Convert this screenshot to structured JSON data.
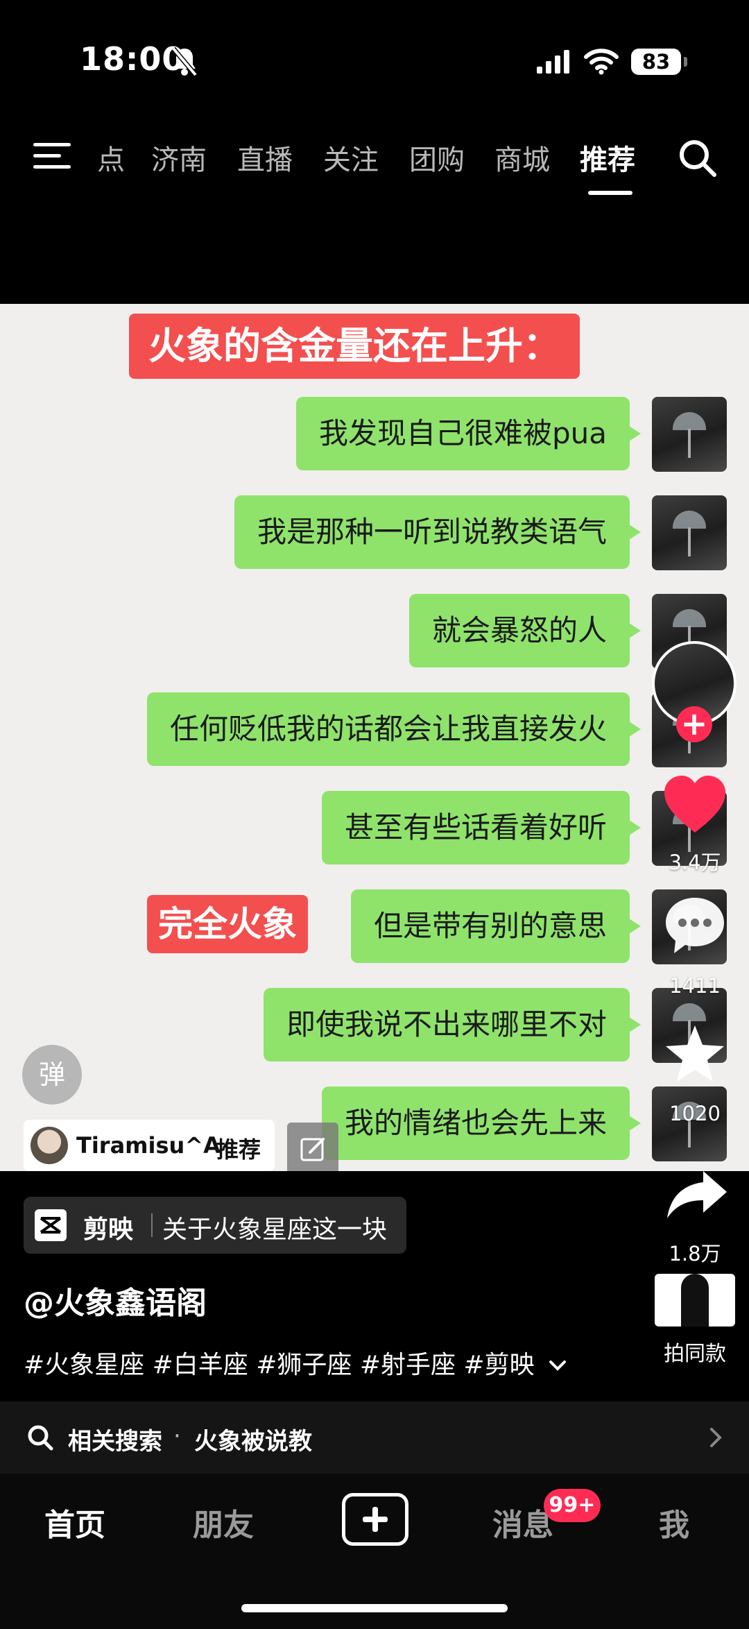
{
  "status_bar": {
    "time": "18:00",
    "battery": "83"
  },
  "top_tabs": [
    "点",
    "济南",
    "直播",
    "关注",
    "团购",
    "商城",
    "推荐"
  ],
  "video": {
    "title": "火象的含金量还在上升：",
    "messages": [
      "我发现自己很难被pua",
      "我是那种一听到说教类语气",
      "就会暴怒的人",
      "任何贬低我的话都会让我直接发火",
      "甚至有些话看着好听",
      "但是带有别的意思",
      "即使我说不出来哪里不对",
      "我的情绪也会先上来"
    ],
    "tag": "完全火象",
    "danmaku_label": "弹",
    "recommender": {
      "name": "Tiramisu^A",
      "label": "推荐"
    }
  },
  "actions": {
    "likes": "3.4万",
    "comments": "1411",
    "favorites": "1020",
    "shares": "1.8万",
    "same_style": "拍同款"
  },
  "capcut": {
    "app": "剪映",
    "text": "关于火象星座这一块"
  },
  "author": "@火象鑫语阁",
  "hashtags": "#火象星座 #白羊座 #狮子座 #射手座 #剪映",
  "related_search": {
    "label": "相关搜索",
    "sep": "·",
    "query": "火象被说教"
  },
  "bottom_nav": {
    "home": "首页",
    "friends": "朋友",
    "messages": "消息",
    "badge": "99+",
    "me": "我"
  },
  "colors": {
    "bubble": "#8fe36b",
    "tag_red": "#f34f4f",
    "like_red": "#fe2c55"
  }
}
